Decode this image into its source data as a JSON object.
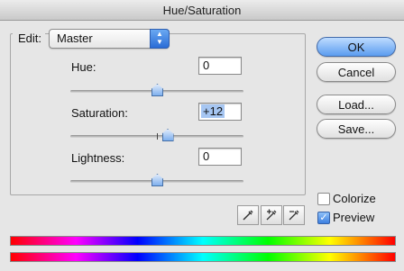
{
  "window": {
    "title": "Hue/Saturation"
  },
  "edit": {
    "label": "Edit:",
    "selected": "Master"
  },
  "hue": {
    "label": "Hue:",
    "value": "0",
    "level": 0.5
  },
  "saturation": {
    "label": "Saturation:",
    "value": "+12",
    "level": 0.56
  },
  "lightness": {
    "label": "Lightness:",
    "value": "0",
    "level": 0.5
  },
  "buttons": {
    "ok": "OK",
    "cancel": "Cancel",
    "load": "Load...",
    "save": "Save..."
  },
  "options": {
    "colorize": "Colorize",
    "preview": "Preview",
    "colorize_checked": false,
    "preview_checked": true
  },
  "colors": {
    "accent": "#5b9cef"
  }
}
